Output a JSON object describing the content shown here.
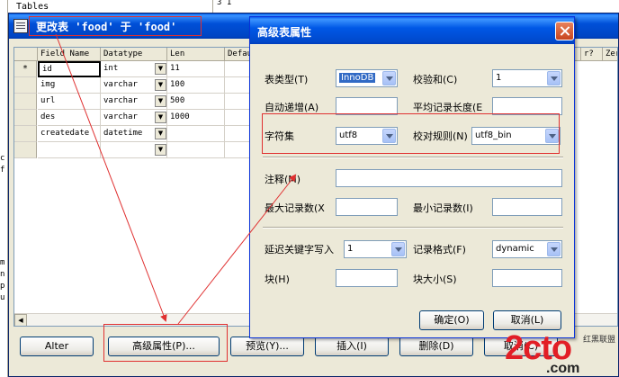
{
  "background": {
    "tables_label": "Tables",
    "right_strip_chars": "3 1",
    "left_letters": [
      "c",
      "f",
      "m",
      "n",
      "p",
      "u"
    ]
  },
  "main_window": {
    "title": "更改表 'food' 于 'food'"
  },
  "grid": {
    "headers": [
      "Field Name",
      "Datatype",
      "Len",
      "Default",
      "r?",
      "Zer"
    ],
    "rows": [
      {
        "marker": "*",
        "field": "id",
        "datatype": "int",
        "len": "11"
      },
      {
        "marker": "",
        "field": "img",
        "datatype": "varchar",
        "len": "100"
      },
      {
        "marker": "",
        "field": "url",
        "datatype": "varchar",
        "len": "500"
      },
      {
        "marker": "",
        "field": "des",
        "datatype": "varchar",
        "len": "1000"
      },
      {
        "marker": "",
        "field": "createdate",
        "datatype": "datetime",
        "len": ""
      },
      {
        "marker": "",
        "field": "",
        "datatype": "",
        "len": ""
      }
    ],
    "scroll_arrow": "◀"
  },
  "buttons": {
    "alter": "Alter",
    "advanced": "高级属性(P)...",
    "preview": "预览(Y)...",
    "insert": "插入(I)",
    "delete": "删除(D)",
    "cancel": "取消(C)"
  },
  "dialog": {
    "title": "高级表属性",
    "table_type_label": "表类型(T)",
    "table_type_value": "InnoDB",
    "checksum_label": "校验和(C)",
    "checksum_value": "1",
    "auto_increment_label": "自动递增(A)",
    "auto_increment_value": "",
    "avg_row_length_label": "平均记录长度(E",
    "avg_row_length_value": "",
    "charset_label": "字符集",
    "charset_value": "utf8",
    "collation_label": "校对规则(N)",
    "collation_value": "utf8_bin",
    "comment_label": "注释(M)",
    "comment_value": "",
    "max_rows_label": "最大记录数(X",
    "max_rows_value": "",
    "min_rows_label": "最小记录数(I)",
    "min_rows_value": "",
    "delay_key_write_label": "延迟关键字写入",
    "delay_key_write_value": "1",
    "row_format_label": "记录格式(F)",
    "row_format_value": "dynamic",
    "block_label": "块(H)",
    "block_value": "",
    "block_size_label": "块大小(S)",
    "block_size_value": "",
    "ok_button": "确定(O)",
    "cancel_button": "取消(L)"
  },
  "watermark": {
    "big": "2cto",
    "small": ".com",
    "corner": "红黑联盟"
  },
  "colors": {
    "annotation_red": "#e03030",
    "titlebar_blue": "#0054e3",
    "dialog_bg": "#ece9d8"
  }
}
